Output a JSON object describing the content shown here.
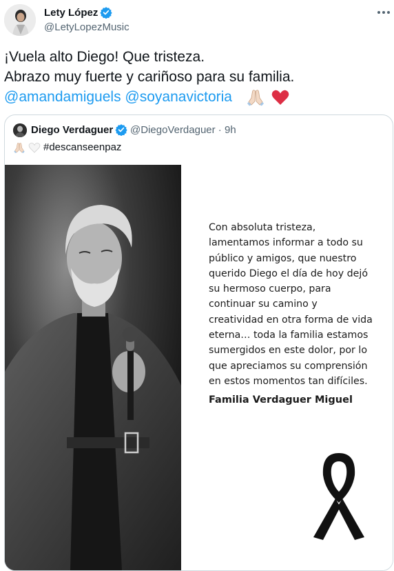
{
  "author": {
    "name": "Lety López",
    "handle": "@LetyLopezMusic"
  },
  "tweet": {
    "line1": "¡Vuela alto Diego! Que tristeza.",
    "line2": "Abrazo muy fuerte y cariñoso para su familia.",
    "mention1": "@amandamiguels",
    "mention2": "@soyanavictoria",
    "emoji": [
      "folded-hands",
      "red-heart"
    ]
  },
  "quoted": {
    "name": "Diego Verdaguer",
    "handle_time": "@DiegoVerdaguer · 9h",
    "text": "#descanseenpaz",
    "emoji": [
      "folded-hands",
      "white-heart"
    ],
    "image_text": {
      "lines": [
        "Con absoluta tristeza,",
        "lamentamos informar a todo su",
        "público y amigos, que nuestro",
        "querido Diego el día de hoy dejó",
        "su hermoso cuerpo, para",
        "continuar su camino y",
        "creatividad en otra forma de vida",
        "eterna… toda la familia estamos",
        "sumergidos en este dolor, por lo",
        "que apreciamos su comprensión",
        "en estos momentos tan difíciles."
      ],
      "signature": "Familia Verdaguer Miguel"
    }
  },
  "colors": {
    "accent": "#1d9bf0",
    "text": "#0f1419",
    "secondary": "#536471",
    "border": "#cfd9de",
    "heart": "#e0245e"
  }
}
